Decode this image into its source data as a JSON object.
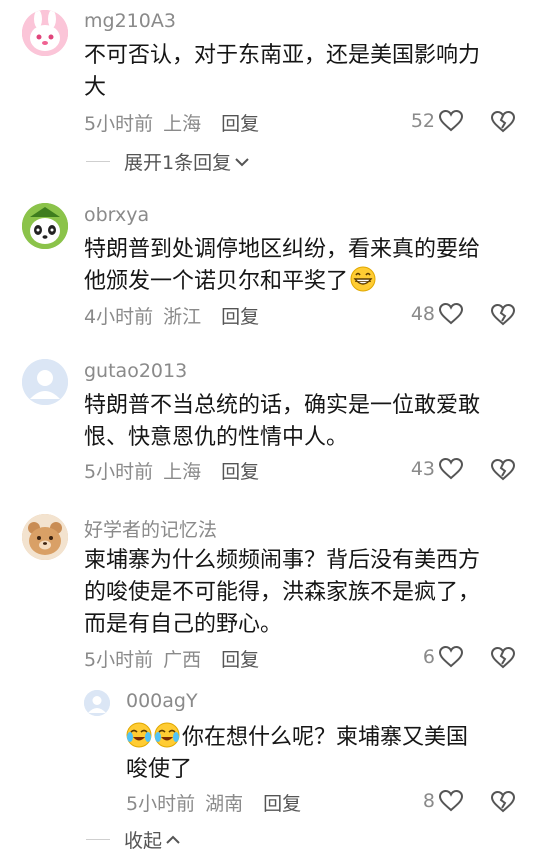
{
  "comments": [
    {
      "username": "mg210A3",
      "lines": [
        "不可否认，对于东南亚，还是美国影响力",
        "大"
      ],
      "time": "5小时前",
      "location": "上海",
      "reply_label": "回复",
      "likes": "52"
    },
    {
      "username": "obrxya",
      "lines": [
        "特朗普到处调停地区纠纷，看来真的要给",
        "他颁发一个诺贝尔和平奖了"
      ],
      "time": "4小时前",
      "location": "浙江",
      "reply_label": "回复",
      "likes": "48"
    },
    {
      "username": "gutao2013",
      "lines": [
        "特朗普不当总统的话，确实是一位敢爱敢",
        "恨、快意恩仇的性情中人。"
      ],
      "time": "5小时前",
      "location": "上海",
      "reply_label": "回复",
      "likes": "43"
    },
    {
      "username": "好学者的记忆法",
      "lines": [
        "柬埔寨为什么频频闹事？背后没有美西方",
        "的唆使是不可能得，洪森家族不是疯了，",
        "而是有自己的野心。"
      ],
      "time": "5小时前",
      "location": "广西",
      "reply_label": "回复",
      "likes": "6"
    }
  ],
  "reply": {
    "username": "000agY",
    "lines": [
      "你在想什么呢？柬埔寨又美国",
      "唆使了"
    ],
    "time": "5小时前",
    "location": "湖南",
    "reply_label": "回复",
    "likes": "8"
  },
  "expand_replies_label": "展开1条回复",
  "collapse_label": "收起",
  "colors": {
    "meta_text": "#8a8a8a",
    "body_text": "#161616",
    "avatar_pink": "#f7a9c4",
    "avatar_panda_bg": "#7cb342",
    "avatar_default": "#d6e4f5",
    "avatar_bear": "#e2b78a"
  }
}
